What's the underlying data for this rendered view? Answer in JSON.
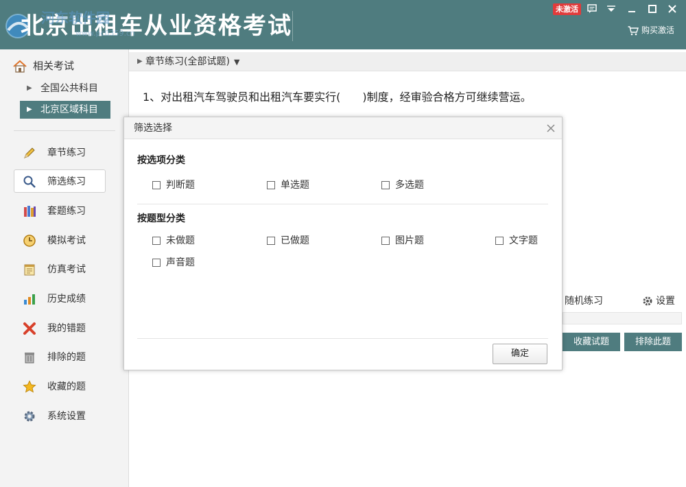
{
  "titlebar": {
    "title": "北京出租车从业资格考试",
    "watermark": "河东软件园",
    "watermark_url": "www.pc0359.cn",
    "badge": "未激活",
    "buy_label": "购买激活",
    "accent_color": "#4f7c7f"
  },
  "sidebar": {
    "related_label": "相关考试",
    "subjects": [
      {
        "label": "全国公共科目",
        "active": false
      },
      {
        "label": "北京区域科目",
        "active": true
      }
    ],
    "nav": [
      {
        "label": "章节练习",
        "icon": "pencil-icon"
      },
      {
        "label": "筛选练习",
        "icon": "magnifier-icon",
        "active": true
      },
      {
        "label": "套题练习",
        "icon": "books-icon"
      },
      {
        "label": "模拟考试",
        "icon": "clock-icon"
      },
      {
        "label": "仿真考试",
        "icon": "notepad-icon"
      },
      {
        "label": "历史成绩",
        "icon": "bar-chart-icon"
      },
      {
        "label": "我的错题",
        "icon": "red-x-icon"
      },
      {
        "label": "排除的题",
        "icon": "trash-icon"
      },
      {
        "label": "收藏的题",
        "icon": "star-icon"
      },
      {
        "label": "系统设置",
        "icon": "gear-icon"
      }
    ]
  },
  "main": {
    "breadcrumb": "章节练习(全部试题)",
    "question": "1、对出租汽车驾驶员和出租汽车要实行(　　)制度，经审验合格方可继续营运。",
    "random_label": "随机练习",
    "settings_label": "设置",
    "collect_button": "收藏试题",
    "exclude_button": "排除此题"
  },
  "dialog": {
    "title": "筛选选择",
    "section1": "按选项分类",
    "options1": [
      "判断题",
      "单选题",
      "多选题"
    ],
    "section2": "按题型分类",
    "options2": [
      "未做题",
      "已做题",
      "图片题",
      "文字题",
      "声音题"
    ],
    "ok_label": "确定"
  }
}
